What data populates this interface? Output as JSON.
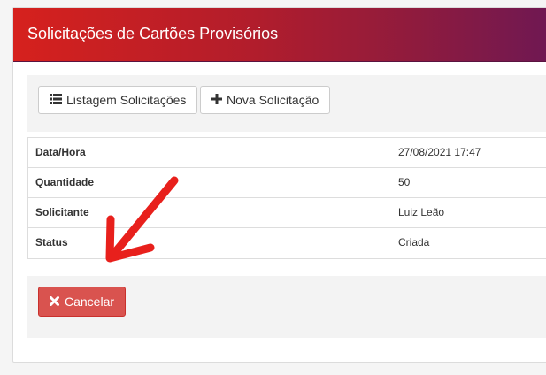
{
  "panel": {
    "title": "Solicitações de Cartões Provisórios"
  },
  "toolbar": {
    "list_button": {
      "label": "Listagem Solicitações",
      "icon": "list-icon"
    },
    "new_button": {
      "label": "Nova Solicitação",
      "icon": "plus-icon"
    }
  },
  "details": [
    {
      "label": "Data/Hora",
      "value": "27/08/2021 17:47"
    },
    {
      "label": "Quantidade",
      "value": "50"
    },
    {
      "label": "Solicitante",
      "value": "Luiz Leão"
    },
    {
      "label": "Status",
      "value": "Criada"
    }
  ],
  "actions": {
    "cancel_button": {
      "label": "Cancelar",
      "icon": "close-icon"
    }
  },
  "annotation": {
    "type": "hand-drawn-arrow",
    "color": "#e8201c"
  },
  "colors": {
    "header_start": "#d6211d",
    "header_end": "#6e1853",
    "danger": "#d9534f"
  }
}
